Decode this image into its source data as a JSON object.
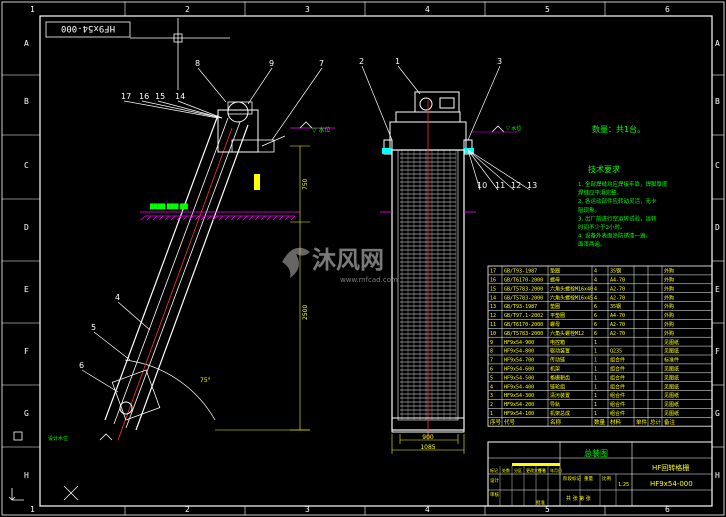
{
  "drawing": {
    "drawing_code": "HF9x54-000",
    "scale_label": "数量：共1台。",
    "frame_columns": [
      "1",
      "2",
      "3",
      "4",
      "5",
      "6"
    ],
    "frame_rows": [
      "A",
      "B",
      "C",
      "D",
      "E",
      "F",
      "G",
      "H"
    ],
    "callouts_side": [
      "8",
      "9",
      "7",
      "17",
      "16",
      "15",
      "14",
      "4",
      "5",
      "6"
    ],
    "callouts_front": [
      "2",
      "1",
      "3",
      "10",
      "11",
      "12",
      "13"
    ],
    "dimensions": [
      "750",
      "2500",
      "75°",
      "900",
      "1085"
    ],
    "tech_title": "技术要求",
    "tech_lines": [
      "1. 全部焊缝均应焊接牢靠，焊脚厚度",
      "   焊缝应平滑完整。",
      "2. 各运动部件应转动灵活，无卡",
      "   阻现象。",
      "3. 出厂前进行空运转试验，运转",
      "   时间不少于2小时。",
      "4. 设备外表面涂防锈漆一遍，",
      "   面漆两遍。"
    ],
    "watermark_text": "沐风网",
    "watermark_url": "www.mfcad.com",
    "bom": {
      "headers": [
        "序号",
        "代号",
        "名称",
        "数量",
        "材料",
        "单件",
        "总计",
        "备注"
      ],
      "rows": [
        [
          "17",
          "GB/T93-1987",
          "垫圈",
          "4",
          "35钢",
          "",
          "",
          "外购"
        ],
        [
          "16",
          "GB/T6170-2000",
          "螺母",
          "4",
          "A4-70",
          "",
          "",
          "外购"
        ],
        [
          "15",
          "GB/T5783-2000",
          "六角头螺栓M16x40",
          "4",
          "A2-70",
          "",
          "",
          "外购"
        ],
        [
          "14",
          "GB/T5783-2000",
          "六角头螺栓M16x45",
          "4",
          "A2-70",
          "",
          "",
          "外购"
        ],
        [
          "13",
          "GB/T93-1987",
          "垫圈",
          "6",
          "35钢",
          "",
          "",
          "外购"
        ],
        [
          "12",
          "GB/T97.1-2002",
          "平垫圈",
          "6",
          "A4-70",
          "",
          "",
          "外购"
        ],
        [
          "11",
          "GB/T6170-2000",
          "螺母",
          "6",
          "A2-70",
          "",
          "",
          "外购"
        ],
        [
          "10",
          "GB/T5783-2000",
          "六角头螺栓M12",
          "6",
          "A2-70",
          "",
          "",
          "外购"
        ],
        [
          "9",
          "HF9x54-900",
          "电控箱",
          "1",
          "",
          "",
          "",
          "见图纸"
        ],
        [
          "8",
          "HF9x54-800",
          "驱动装置",
          "1",
          "Q235",
          "",
          "",
          "见图纸"
        ],
        [
          "7",
          "HF9x54-700",
          "传动链",
          "1",
          "组合件",
          "",
          "",
          "标准件"
        ],
        [
          "6",
          "HF9x54-600",
          "机架",
          "1",
          "组合件",
          "",
          "",
          "见图纸"
        ],
        [
          "5",
          "HF9x54-500",
          "格栅耙齿",
          "1",
          "组合件",
          "",
          "",
          "见图纸"
        ],
        [
          "4",
          "HF9x54-400",
          "链轮组",
          "1",
          "组合件",
          "",
          "",
          "见图纸"
        ],
        [
          "3",
          "HF9x54-300",
          "清污装置",
          "1",
          "组合件",
          "",
          "",
          "见图纸"
        ],
        [
          "2",
          "HF9x54-200",
          "导轨",
          "1",
          "组合件",
          "",
          "",
          "见图纸"
        ],
        [
          "1",
          "HF9x54-100",
          "机架总成",
          "1",
          "组合件",
          "",
          "",
          "见图纸"
        ]
      ]
    },
    "title_block": {
      "view_title": "总装图",
      "product_name": "HF回转格栅",
      "drawing_no": "HF9x54-000",
      "labels": [
        "标记",
        "处数",
        "分区",
        "更改文件号",
        "签名",
        "年月日"
      ],
      "label_design": "设计",
      "label_check": "审核",
      "label_approve": "批准",
      "label_stage": "阶段标记",
      "label_weight": "重量",
      "label_scale": "比例",
      "scale_value": "1:25",
      "sheet_text": "共 张 第 张"
    },
    "colors": {
      "background": "#000000",
      "frame": "#ffffff",
      "geometry": "#ffffff",
      "dimension": "#ffff00",
      "callout": "#ffffff",
      "hatch": "#ff00ff",
      "center": "#ff3030",
      "text_green": "#00ff00",
      "cyan": "#00ffff",
      "table_text": "#ffff00"
    }
  }
}
